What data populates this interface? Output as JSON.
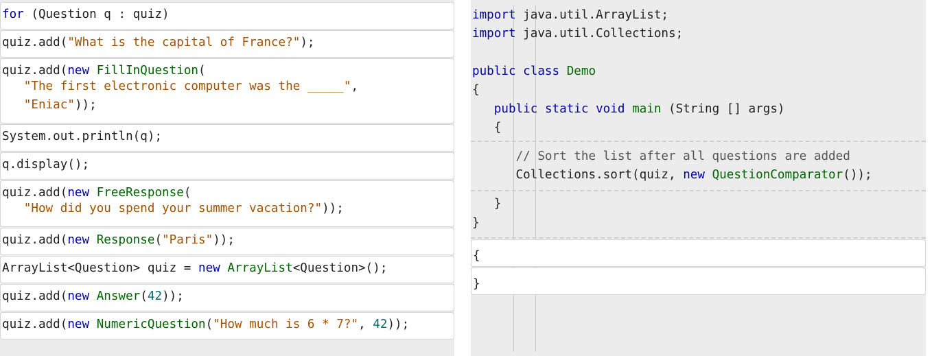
{
  "source_blocks": [
    {
      "lines": [
        [
          {
            "t": "for",
            "c": "kw"
          },
          {
            "t": " (Question q : quiz)",
            "c": "pl"
          }
        ]
      ]
    },
    {
      "lines": [
        [
          {
            "t": "quiz.add(",
            "c": "pl"
          },
          {
            "t": "\"What is the capital of France?\"",
            "c": "str"
          },
          {
            "t": ");",
            "c": "pl"
          }
        ]
      ]
    },
    {
      "lines": [
        [
          {
            "t": "quiz.add(",
            "c": "pl"
          },
          {
            "t": "new",
            "c": "kw"
          },
          {
            "t": " ",
            "c": "pl"
          },
          {
            "t": "FillInQuestion",
            "c": "cls"
          },
          {
            "t": "(",
            "c": "pl"
          }
        ],
        [
          {
            "t": "   ",
            "c": "pl"
          },
          {
            "t": "\"The first electronic computer was the _____\"",
            "c": "str"
          },
          {
            "t": ",",
            "c": "pl"
          }
        ],
        [
          {
            "t": "   ",
            "c": "pl"
          },
          {
            "t": "\"Eniac\"",
            "c": "str"
          },
          {
            "t": "));",
            "c": "pl"
          }
        ]
      ]
    },
    {
      "lines": [
        [
          {
            "t": "System.out.println(q);",
            "c": "pl"
          }
        ]
      ]
    },
    {
      "lines": [
        [
          {
            "t": "q.display();",
            "c": "pl"
          }
        ]
      ]
    },
    {
      "lines": [
        [
          {
            "t": "quiz.add(",
            "c": "pl"
          },
          {
            "t": "new",
            "c": "kw"
          },
          {
            "t": " ",
            "c": "pl"
          },
          {
            "t": "FreeResponse",
            "c": "cls"
          },
          {
            "t": "(",
            "c": "pl"
          }
        ],
        [
          {
            "t": "   ",
            "c": "pl"
          },
          {
            "t": "\"How did you spend your summer vacation?\"",
            "c": "str"
          },
          {
            "t": "));",
            "c": "pl"
          }
        ]
      ]
    },
    {
      "lines": [
        [
          {
            "t": "quiz.add(",
            "c": "pl"
          },
          {
            "t": "new",
            "c": "kw"
          },
          {
            "t": " ",
            "c": "pl"
          },
          {
            "t": "Response",
            "c": "cls"
          },
          {
            "t": "(",
            "c": "pl"
          },
          {
            "t": "\"Paris\"",
            "c": "str"
          },
          {
            "t": "));",
            "c": "pl"
          }
        ]
      ]
    },
    {
      "lines": [
        [
          {
            "t": "ArrayList<Question> quiz = ",
            "c": "pl"
          },
          {
            "t": "new",
            "c": "kw"
          },
          {
            "t": " ",
            "c": "pl"
          },
          {
            "t": "ArrayList",
            "c": "cls"
          },
          {
            "t": "<Question>();",
            "c": "pl"
          }
        ]
      ]
    },
    {
      "lines": [
        [
          {
            "t": "quiz.add(",
            "c": "pl"
          },
          {
            "t": "new",
            "c": "kw"
          },
          {
            "t": " ",
            "c": "pl"
          },
          {
            "t": "Answer",
            "c": "cls"
          },
          {
            "t": "(",
            "c": "pl"
          },
          {
            "t": "42",
            "c": "num"
          },
          {
            "t": "));",
            "c": "pl"
          }
        ]
      ]
    },
    {
      "lines": [
        [
          {
            "t": "quiz.add(",
            "c": "pl"
          },
          {
            "t": "new",
            "c": "kw"
          },
          {
            "t": " ",
            "c": "pl"
          },
          {
            "t": "NumericQuestion",
            "c": "cls"
          },
          {
            "t": "(",
            "c": "pl"
          },
          {
            "t": "\"How much is 6 * 7?\"",
            "c": "str"
          },
          {
            "t": ", ",
            "c": "pl"
          },
          {
            "t": "42",
            "c": "num"
          },
          {
            "t": "));",
            "c": "pl"
          }
        ]
      ]
    }
  ],
  "target_fixed_lines": [
    [
      {
        "t": "import",
        "c": "kw"
      },
      {
        "t": " java.util.ArrayList;",
        "c": "pl"
      }
    ],
    [
      {
        "t": "import",
        "c": "kw"
      },
      {
        "t": " java.util.Collections;",
        "c": "pl"
      }
    ],
    [
      {
        "t": "public",
        "c": "kw"
      },
      {
        "t": " ",
        "c": "pl"
      },
      {
        "t": "class",
        "c": "kw"
      },
      {
        "t": " ",
        "c": "pl"
      },
      {
        "t": "Demo",
        "c": "cls"
      }
    ],
    [
      {
        "t": "{",
        "c": "pl"
      }
    ],
    [
      {
        "t": "   ",
        "c": "pl"
      },
      {
        "t": "public",
        "c": "kw"
      },
      {
        "t": " ",
        "c": "pl"
      },
      {
        "t": "static",
        "c": "kw"
      },
      {
        "t": " ",
        "c": "pl"
      },
      {
        "t": "void",
        "c": "kw"
      },
      {
        "t": " ",
        "c": "pl"
      },
      {
        "t": "main",
        "c": "cls"
      },
      {
        "t": " (String [] args)",
        "c": "pl"
      }
    ],
    [
      {
        "t": "   {",
        "c": "pl"
      }
    ],
    [
      {
        "t": "      ",
        "c": "pl"
      },
      {
        "t": "// Sort the list after all questions are added",
        "c": "cm"
      }
    ],
    [
      {
        "t": "      Collections.sort(quiz, ",
        "c": "pl"
      },
      {
        "t": "new",
        "c": "kw"
      },
      {
        "t": " ",
        "c": "pl"
      },
      {
        "t": "QuestionComparator",
        "c": "cls"
      },
      {
        "t": "());",
        "c": "pl"
      }
    ],
    [
      {
        "t": "   }",
        "c": "pl"
      }
    ],
    [
      {
        "t": "}",
        "c": "pl"
      }
    ]
  ],
  "target_placed_blocks": [
    [
      {
        "t": "{",
        "c": "pl"
      }
    ],
    [
      {
        "t": "}",
        "c": "pl"
      }
    ]
  ],
  "colors": {
    "keyword": "#00009e",
    "string": "#a05300",
    "class_name": "#006400",
    "number": "#0a6b6b",
    "comment": "#555555",
    "area_background": "#ececec",
    "block_background": "#ffffff"
  }
}
